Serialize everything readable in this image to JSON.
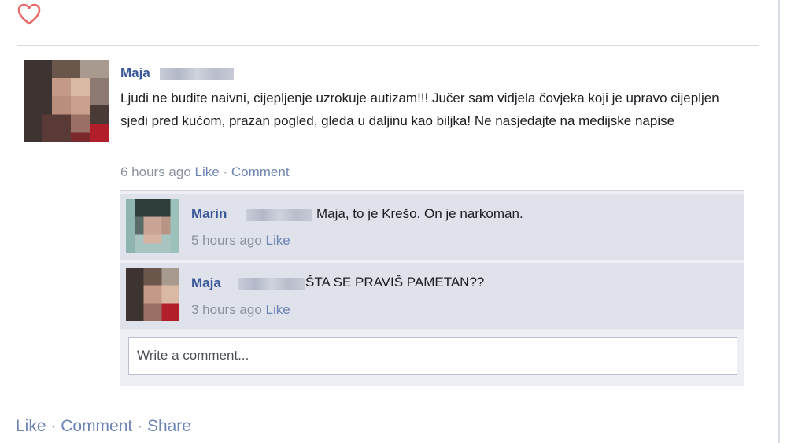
{
  "post": {
    "author": "Maja",
    "text": "Ljudi ne budite naivni, cijepljenje uzrokuje autizam!!! Jučer sam vidjela čovjeka koji je upravo cijepljen sjedi pred kućom, prazan pogled, gleda u daljinu kao biljka! Ne nasjedajte na medijske napise",
    "time": "6 hours ago",
    "like_label": "Like",
    "separator": "·",
    "comment_label": "Comment"
  },
  "comments": [
    {
      "author": "Marin",
      "text": "Maja, to je Krešo. On je narkoman.",
      "time": "5 hours ago",
      "like_label": "Like"
    },
    {
      "author": "Maja",
      "text": "ŠTA SE PRAVIŠ PAMETAN??",
      "time": "3 hours ago",
      "like_label": "Like"
    }
  ],
  "comment_input": {
    "placeholder": "Write a comment..."
  },
  "footer": {
    "like_label": "Like",
    "comment_label": "Comment",
    "share_label": "Share",
    "separator": "·"
  },
  "colors": {
    "link": "#3b5998",
    "muted_link": "#6d84b4",
    "heart": "#e86a6a",
    "comment_bg": "#dfe2ea"
  },
  "icons": {
    "heart": "heart-icon"
  }
}
